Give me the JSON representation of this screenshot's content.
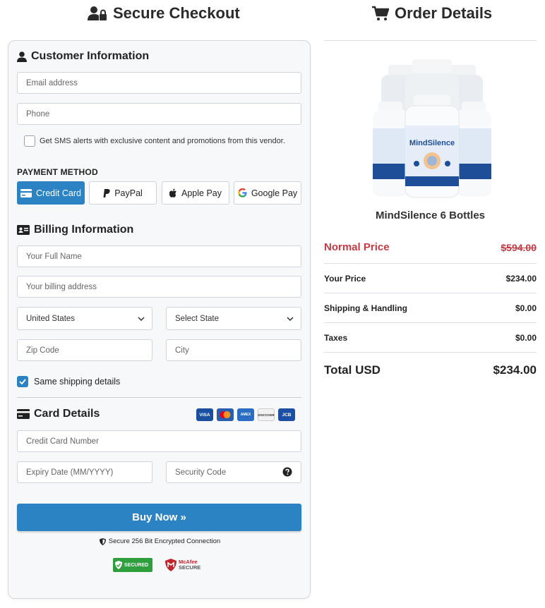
{
  "checkout": {
    "heading": "Secure Checkout",
    "customer_title": "Customer Information",
    "email_placeholder": "Email address",
    "phone_placeholder": "Phone",
    "sms_label": "Get SMS alerts with exclusive content and promotions from this vendor.",
    "payment_method_label": "PAYMENT METHOD",
    "payment_methods": [
      {
        "label": "Credit Card",
        "icon": "credit-card-icon"
      },
      {
        "label": "PayPal",
        "icon": "paypal-icon"
      },
      {
        "label": "Apple Pay",
        "icon": "apple-icon"
      },
      {
        "label": "Google Pay",
        "icon": "google-icon"
      }
    ],
    "billing_title": "Billing Information",
    "full_name_placeholder": "Your Full Name",
    "address_placeholder": "Your billing address",
    "country_value": "United States",
    "state_value": "Select State",
    "zip_placeholder": "Zip Code",
    "city_placeholder": "City",
    "same_shipping_label": "Same shipping details",
    "card_title": "Card Details",
    "card_brands": [
      "VISA",
      "mastercard",
      "AMEX",
      "DISCOVER",
      "JCB"
    ],
    "card_number_placeholder": "Credit Card Number",
    "expiry_placeholder": "Expiry Date (MM/YYYY)",
    "security_code_placeholder": "Security Code",
    "buy_label": "Buy Now »",
    "secure_line": "Secure 256 Bit Encrypted Connection",
    "badge_trustedsite": "SECURED",
    "badge_mcafee_1": "McAfee",
    "badge_mcafee_2": "SECURE"
  },
  "order": {
    "heading": "Order Details",
    "product_name": "MindSilence 6 Bottles",
    "bottle_brand": "MindSilence",
    "normal_price_label": "Normal Price",
    "normal_price_value": "$594.00",
    "your_price_label": "Your Price",
    "your_price_value": "$234.00",
    "shipping_label": "Shipping & Handling",
    "shipping_value": "$0.00",
    "taxes_label": "Taxes",
    "taxes_value": "$0.00",
    "total_label": "Total USD",
    "total_value": "$234.00"
  },
  "colors": {
    "accent": "#2b83c4",
    "normal_price": "#c33b45",
    "secured_badge": "#2f9e3c"
  }
}
